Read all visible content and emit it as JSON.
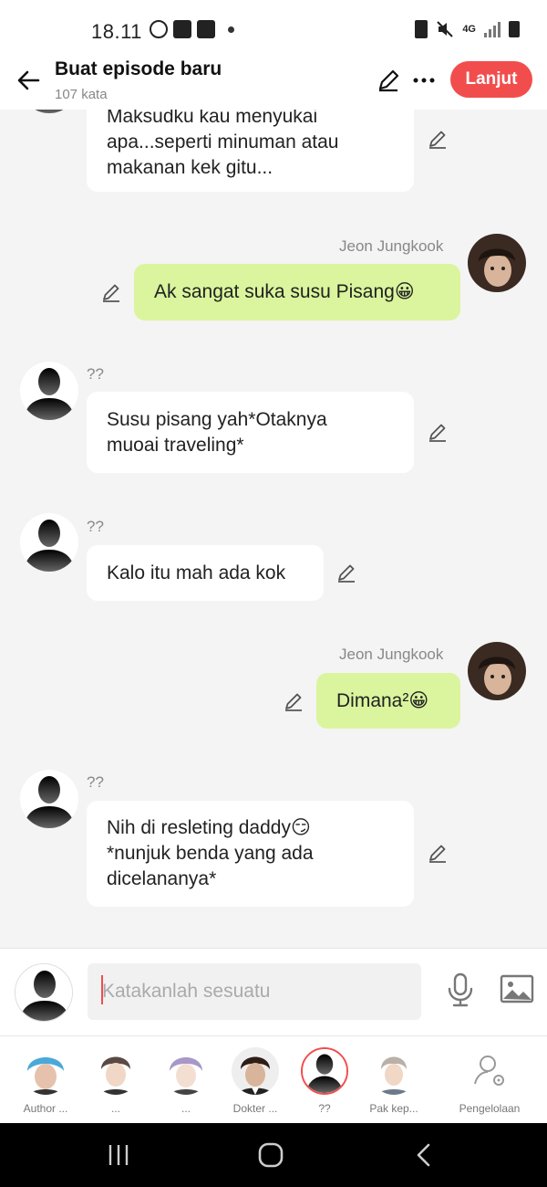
{
  "status_bar": {
    "time": "18.11",
    "network": "4G"
  },
  "header": {
    "title": "Buat episode baru",
    "word_count": "107 kata",
    "next_label": "Lanjut"
  },
  "messages": [
    {
      "side": "left",
      "text": "Maksudku kau menyukai\napa...seperti minuman atau\nmakanan kek gitu..."
    },
    {
      "side": "right",
      "speaker": "Jeon Jungkook",
      "text": "Ak sangat suka susu Pisang😀"
    },
    {
      "side": "left",
      "speaker": "??",
      "text": "Susu pisang yah*Otaknya\nmuoai traveling*"
    },
    {
      "side": "left",
      "speaker": "??",
      "text": "Kalo itu mah ada kok"
    },
    {
      "side": "right",
      "speaker": "Jeon Jungkook",
      "text": "Dimana²😀"
    },
    {
      "side": "left",
      "speaker": "??",
      "text": "Nih di resleting daddy😏\n*nunjuk benda yang ada\ndicelananya*"
    }
  ],
  "input": {
    "placeholder": "Katakanlah sesuatu"
  },
  "characters": [
    {
      "label": "Author ...",
      "color": "#4aa9d8"
    },
    {
      "label": "...",
      "color": "#5b4a44"
    },
    {
      "label": "...",
      "color": "#a898c8"
    },
    {
      "label": "Dokter ...",
      "color": "#6b5040"
    },
    {
      "label": "??",
      "color": "#222222"
    },
    {
      "label": "Pak kep...",
      "color": "#b9b0a8"
    },
    {
      "label": "Pengelolaan",
      "color": "#999999"
    }
  ],
  "colors": {
    "accent": "#f24d4d",
    "own_bubble": "#daf59d",
    "other_bubble": "#ffffff"
  }
}
